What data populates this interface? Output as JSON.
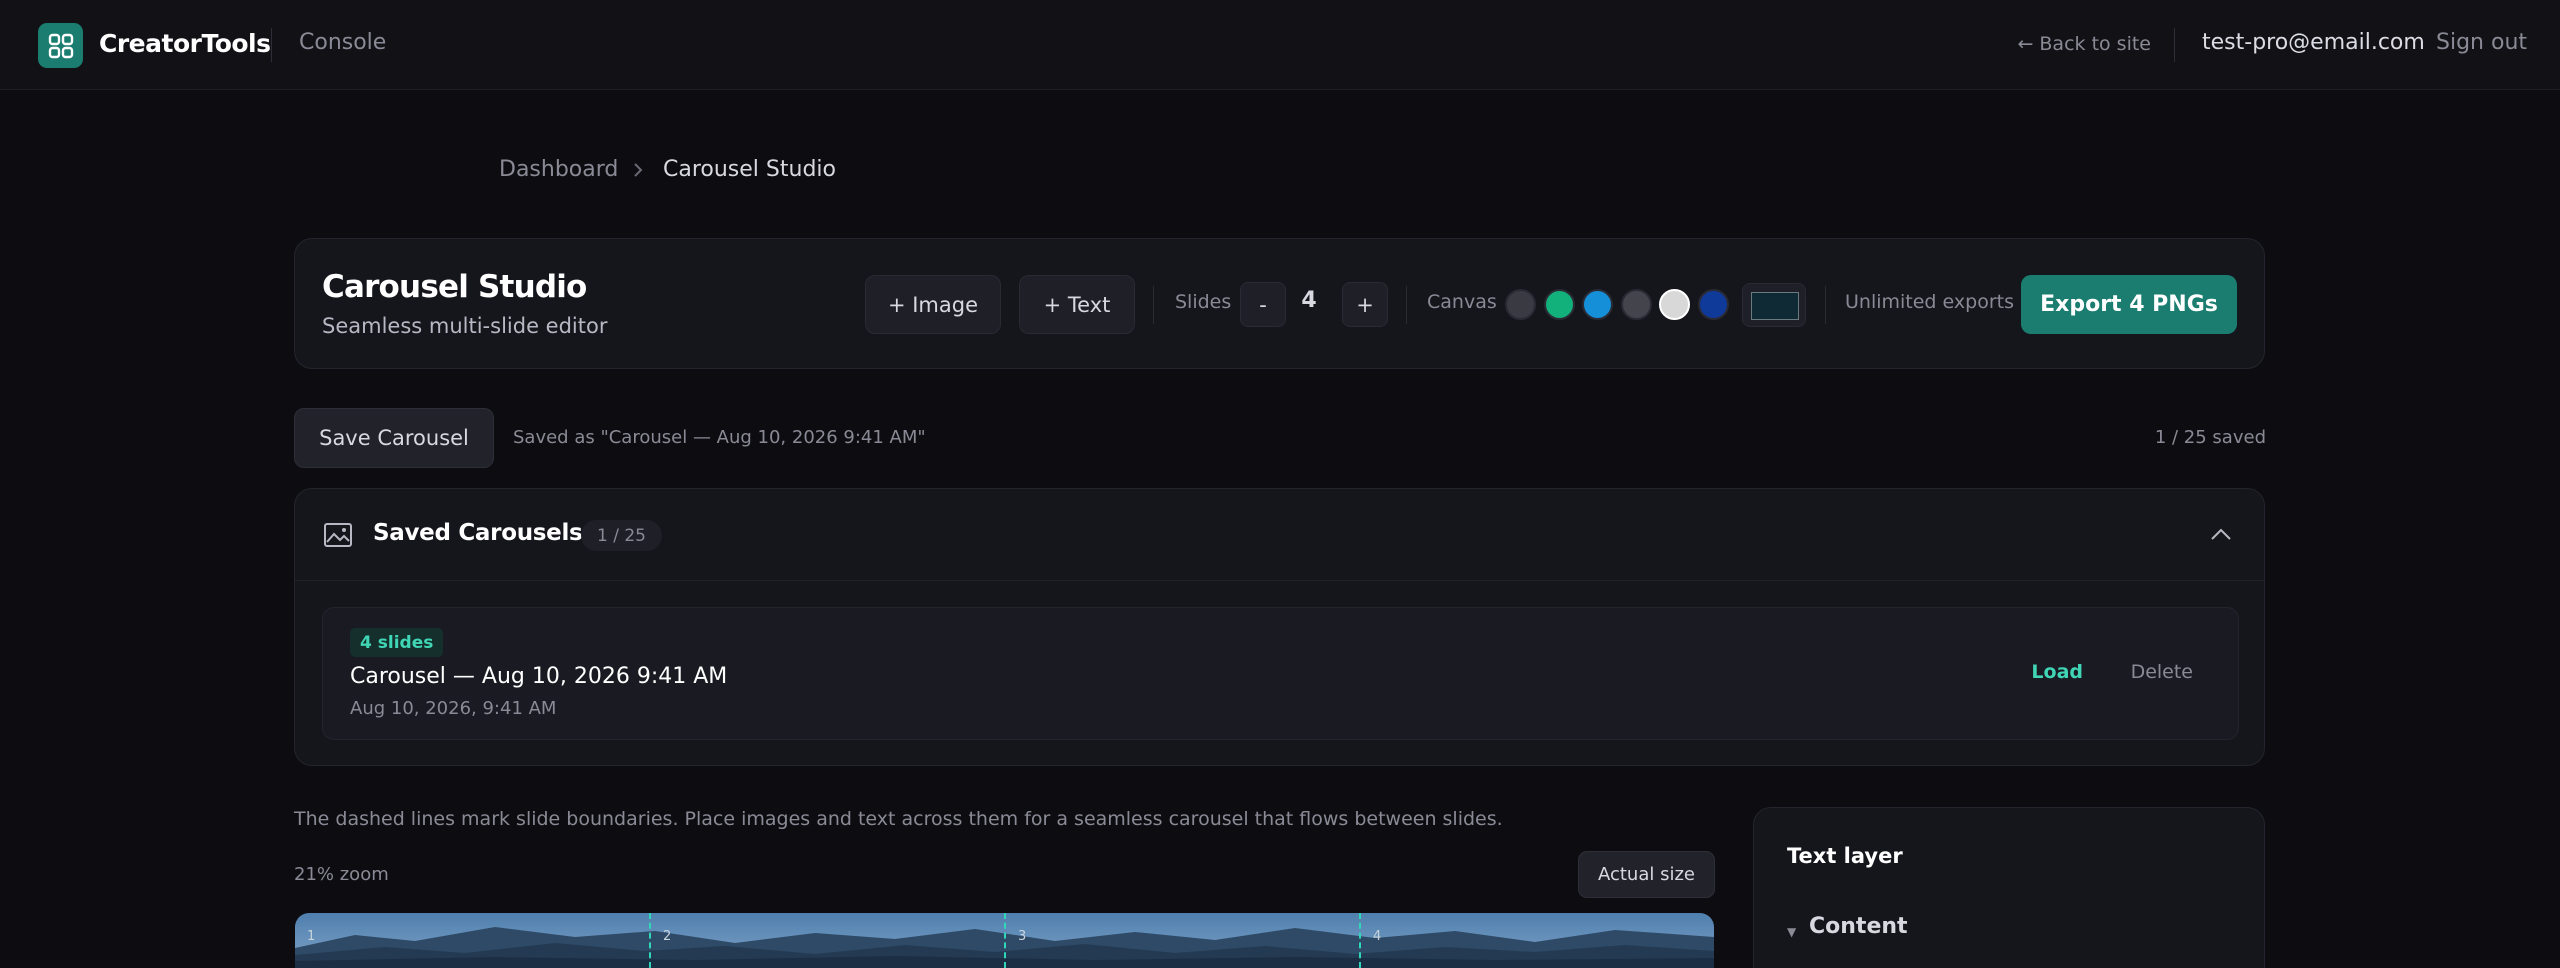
{
  "topbar": {
    "brand": "CreatorTools",
    "section": "Console",
    "back_link": "← Back to site",
    "email": "test-pro@email.com",
    "sign_out": "Sign out",
    "logo_color": "#1a7d70"
  },
  "breadcrumb": {
    "items": [
      "Dashboard",
      "Carousel Studio"
    ]
  },
  "studio": {
    "title": "Carousel Studio",
    "subtitle": "Seamless multi-slide editor",
    "add_image": "+ Image",
    "add_text": "+ Text",
    "slides_label": "Slides",
    "minus": "-",
    "plus": "+",
    "slides_count": "4",
    "canvas_label": "Canvas",
    "swatches": [
      "#3a3a42",
      "#12b07a",
      "#1590d8",
      "#44444c",
      "#d8d8d8",
      "#0f3a9a"
    ],
    "selected_swatch": "#d8d8d8",
    "canvas_color": "#0f2a35",
    "unlimited": "Unlimited exports",
    "export": "Export 4 PNGs",
    "accent": "#1a7d70"
  },
  "save_row": {
    "button": "Save Carousel",
    "saved_as": "Saved as \"Carousel — Aug 10, 2026 9:41 AM\"",
    "count": "1 / 25 saved"
  },
  "saved_panel": {
    "title": "Saved Carousels",
    "badge": "1 / 25",
    "items": [
      {
        "tag": "4 slides",
        "title": "Carousel — Aug 10, 2026 9:41 AM",
        "date": "Aug 10, 2026, 9:41 AM",
        "load": "Load",
        "delete": "Delete"
      }
    ]
  },
  "editor": {
    "hint": "The dashed lines mark slide boundaries. Place images and text across them for a seamless carousel that flows between slides.",
    "zoom": "21% zoom",
    "actual_size": "Actual size",
    "slide_numbers": [
      "1",
      "2",
      "3",
      "4"
    ]
  },
  "text_layer": {
    "title": "Text layer",
    "content_label": "Content"
  }
}
